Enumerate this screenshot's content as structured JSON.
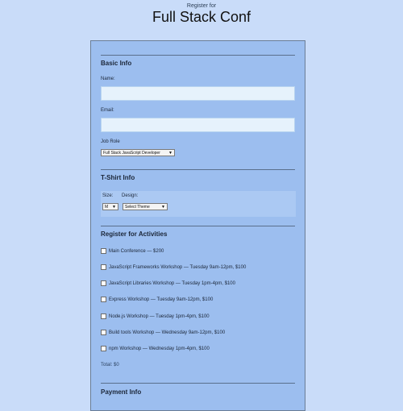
{
  "header": {
    "subtitle": "Register for",
    "title": "Full Stack Conf"
  },
  "basic_info": {
    "heading": "Basic Info",
    "name_label": "Name:",
    "email_label": "Email:",
    "job_role_label": "Job Role",
    "job_role_selected": "Full Stack JavaScript Developer"
  },
  "tshirt": {
    "heading": "T-Shirt Info",
    "size_label": "Size:",
    "size_selected": "M",
    "design_label": "Design:",
    "design_selected": "Select Theme"
  },
  "activities": {
    "heading": "Register for Activities",
    "items": [
      {
        "label": "Main Conference — $200",
        "checked": false
      },
      {
        "label": "JavaScript Frameworks Workshop — Tuesday 9am-12pm, $100",
        "checked": false
      },
      {
        "label": "JavaScript Libraries Workshop — Tuesday 1pm-4pm, $100",
        "checked": false
      },
      {
        "label": "Express Workshop — Tuesday 9am-12pm, $100",
        "checked": false
      },
      {
        "label": "Node.js Workshop — Tuesday 1pm-4pm, $100",
        "checked": false
      },
      {
        "label": "Build tools Workshop — Wednesday 9am-12pm, $100",
        "checked": false
      },
      {
        "label": "npm Workshop — Wednesday 1pm-4pm, $100",
        "checked": false
      }
    ],
    "total": "Total: $0"
  },
  "payment": {
    "heading": "Payment Info"
  },
  "colors": {
    "page_background": "#c9dcf9",
    "form_background": "#9cbeef"
  },
  "icons": {
    "select_arrow": "chevron-down-icon"
  }
}
